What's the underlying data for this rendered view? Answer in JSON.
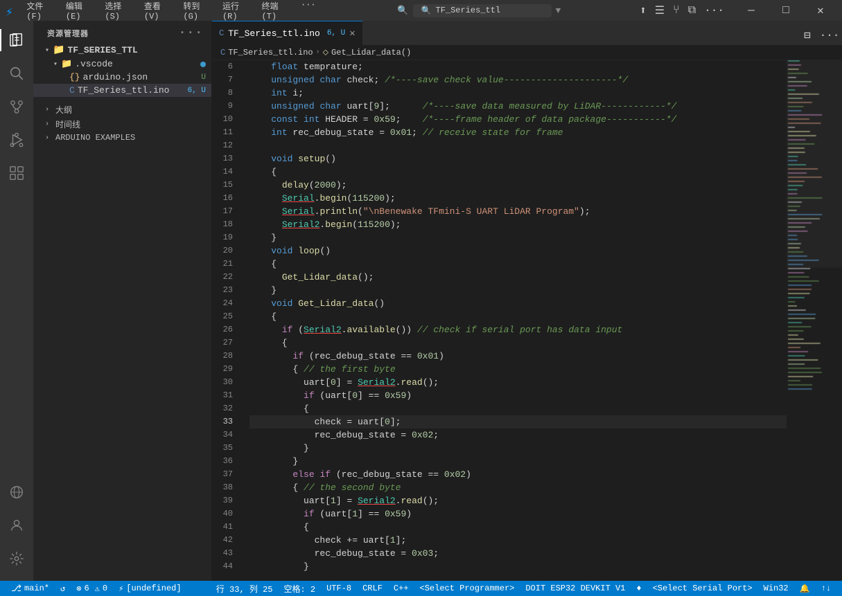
{
  "titleBar": {
    "icon": "⚡",
    "menus": [
      "文件(F)",
      "编辑(E)",
      "选择(S)",
      "查看(V)",
      "转到(G)",
      "运行(R)",
      "终端(T)",
      "···"
    ],
    "search": "TF_Series_ttl",
    "windowBtns": [
      "—",
      "□",
      "✕"
    ]
  },
  "activityBar": {
    "icons": [
      {
        "name": "explorer",
        "symbol": "⧉",
        "active": true
      },
      {
        "name": "search",
        "symbol": "🔍",
        "active": false
      },
      {
        "name": "source-control",
        "symbol": "⑂",
        "active": false
      },
      {
        "name": "run-debug",
        "symbol": "▶",
        "active": false
      },
      {
        "name": "extensions",
        "symbol": "⊞",
        "active": false
      }
    ],
    "bottomIcons": [
      {
        "name": "remote",
        "symbol": "⊕",
        "active": false
      },
      {
        "name": "account",
        "symbol": "◯",
        "active": false
      },
      {
        "name": "settings",
        "symbol": "⚙",
        "active": false
      }
    ]
  },
  "sidebar": {
    "title": "资源管理器",
    "tree": [
      {
        "label": "TF_SERIES_TTL",
        "indent": 0,
        "type": "folder-open",
        "expanded": true
      },
      {
        "label": ".vscode",
        "indent": 1,
        "type": "folder",
        "expanded": true
      },
      {
        "label": "arduino.json",
        "indent": 2,
        "type": "json",
        "badge": "U"
      },
      {
        "label": "TF_Series_ttl.ino",
        "indent": 2,
        "type": "ino",
        "badge": "6, U",
        "active": true
      },
      {
        "label": "大纲",
        "indent": 0,
        "type": "section"
      },
      {
        "label": "时间线",
        "indent": 0,
        "type": "section"
      },
      {
        "label": "ARDUINO EXAMPLES",
        "indent": 0,
        "type": "section"
      }
    ]
  },
  "editor": {
    "tab": {
      "filename": "TF_Series_ttl.ino",
      "modified": true,
      "badge": "6, U"
    },
    "breadcrumb": [
      "TF_Series_ttl.ino",
      "Get_Lidar_data()"
    ],
    "lines": [
      {
        "num": 6,
        "content": "    float temprature;"
      },
      {
        "num": 7,
        "content": "    unsigned char check; /*----save check value---------------------*/"
      },
      {
        "num": 8,
        "content": "    int i;"
      },
      {
        "num": 9,
        "content": "    unsigned char uart[9];      /*----save data measured by LiDAR------------*/"
      },
      {
        "num": 10,
        "content": "    const int HEADER = 0x59;    /*----frame header of data package-----------*/"
      },
      {
        "num": 11,
        "content": "    int rec_debug_state = 0x01; // receive state for frame"
      },
      {
        "num": 12,
        "content": ""
      },
      {
        "num": 13,
        "content": "    void setup()"
      },
      {
        "num": 14,
        "content": "    {"
      },
      {
        "num": 15,
        "content": "      delay(2000);"
      },
      {
        "num": 16,
        "content": "      Serial.begin(115200);"
      },
      {
        "num": 17,
        "content": "      Serial.println(\"\\nBenewake TFmini-S UART LiDAR Program\");"
      },
      {
        "num": 18,
        "content": "      Serial2.begin(115200);"
      },
      {
        "num": 19,
        "content": "    }"
      },
      {
        "num": 20,
        "content": "    void loop()"
      },
      {
        "num": 21,
        "content": "    {"
      },
      {
        "num": 22,
        "content": "      Get_Lidar_data();"
      },
      {
        "num": 23,
        "content": "    }"
      },
      {
        "num": 24,
        "content": "    void Get_Lidar_data()"
      },
      {
        "num": 25,
        "content": "    {"
      },
      {
        "num": 26,
        "content": "      if (Serial2.available()) // check if serial port has data input"
      },
      {
        "num": 27,
        "content": "      {"
      },
      {
        "num": 28,
        "content": "        if (rec_debug_state == 0x01)"
      },
      {
        "num": 29,
        "content": "        { // the first byte"
      },
      {
        "num": 30,
        "content": "          uart[0] = Serial2.read();"
      },
      {
        "num": 31,
        "content": "          if (uart[0] == 0x59)"
      },
      {
        "num": 32,
        "content": "          {"
      },
      {
        "num": 33,
        "content": "            check = uart[0];",
        "active": true
      },
      {
        "num": 34,
        "content": "            rec_debug_state = 0x02;"
      },
      {
        "num": 35,
        "content": "          }"
      },
      {
        "num": 36,
        "content": "        }"
      },
      {
        "num": 37,
        "content": "        else if (rec_debug_state == 0x02)"
      },
      {
        "num": 38,
        "content": "        { // the second byte"
      },
      {
        "num": 39,
        "content": "          uart[1] = Serial2.read();"
      },
      {
        "num": 40,
        "content": "          if (uart[1] == 0x59)"
      },
      {
        "num": 41,
        "content": "          {"
      },
      {
        "num": 42,
        "content": "            check += uart[1];"
      },
      {
        "num": 43,
        "content": "            rec_debug_state = 0x03;"
      },
      {
        "num": 44,
        "content": "          }"
      }
    ]
  },
  "statusBar": {
    "left": [
      {
        "label": "⎇ main*",
        "type": "branch"
      },
      {
        "label": "↺",
        "type": "sync"
      },
      {
        "label": "⊗ 6  ⚠ 0",
        "type": "problems"
      }
    ],
    "right": [
      {
        "label": "行 33, 列 25"
      },
      {
        "label": "空格: 2"
      },
      {
        "label": "UTF-8"
      },
      {
        "label": "CRLF"
      },
      {
        "label": "C++"
      },
      {
        "label": "<Select Programmer>"
      },
      {
        "label": "DOIT ESP32 DEVKIT V1"
      },
      {
        "label": "♦"
      },
      {
        "label": "<Select Serial Port>"
      },
      {
        "label": "Win32"
      },
      {
        "label": "↑↓"
      }
    ]
  }
}
